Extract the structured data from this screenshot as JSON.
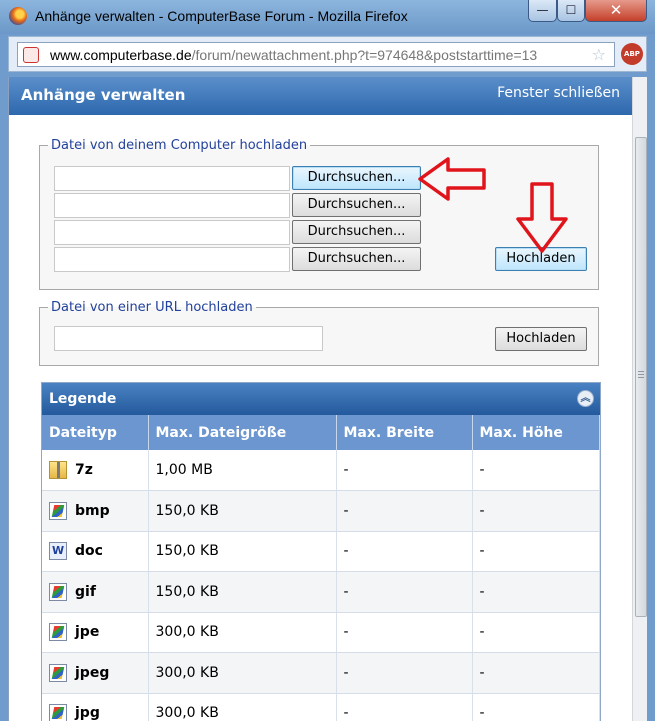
{
  "window": {
    "title": "Anhänge verwalten - ComputerBase Forum - Mozilla Firefox",
    "min_symbol": "—",
    "max_symbol": "☐",
    "close_symbol": "✕"
  },
  "address": {
    "url_domain": "www.computerbase.de",
    "url_rest": "/forum/newattachment.php?t=974648&poststarttime=13",
    "addon_label": "ABP"
  },
  "page": {
    "title": "Anhänge verwalten",
    "close_link": "Fenster schließen"
  },
  "upload_computer": {
    "legend": "Datei von deinem Computer hochladen",
    "browse_label": "Durchsuchen...",
    "upload_label": "Hochladen",
    "file_inputs": [
      "",
      "",
      "",
      ""
    ]
  },
  "upload_url": {
    "legend": "Datei von einer URL hochladen",
    "url_value": "",
    "upload_label": "Hochladen"
  },
  "legend_table": {
    "title": "Legende",
    "columns": [
      "Dateityp",
      "Max. Dateigröße",
      "Max. Breite",
      "Max. Höhe"
    ],
    "rows": [
      {
        "type": "7z",
        "icon": "archive-icon",
        "size": "1,00 MB",
        "width": "-",
        "height": "-"
      },
      {
        "type": "bmp",
        "icon": "image-icon",
        "size": "150,0 KB",
        "width": "-",
        "height": "-"
      },
      {
        "type": "doc",
        "icon": "word-document-icon",
        "size": "150,0 KB",
        "width": "-",
        "height": "-"
      },
      {
        "type": "gif",
        "icon": "image-icon",
        "size": "150,0 KB",
        "width": "-",
        "height": "-"
      },
      {
        "type": "jpe",
        "icon": "image-icon",
        "size": "300,0 KB",
        "width": "-",
        "height": "-"
      },
      {
        "type": "jpeg",
        "icon": "image-icon",
        "size": "300,0 KB",
        "width": "-",
        "height": "-"
      },
      {
        "type": "jpg",
        "icon": "image-icon",
        "size": "300,0 KB",
        "width": "-",
        "height": "-"
      }
    ]
  },
  "colors": {
    "header_blue": "#2d68ad",
    "legend_text": "#22419b",
    "annotation_arrow": "#e0141b"
  }
}
